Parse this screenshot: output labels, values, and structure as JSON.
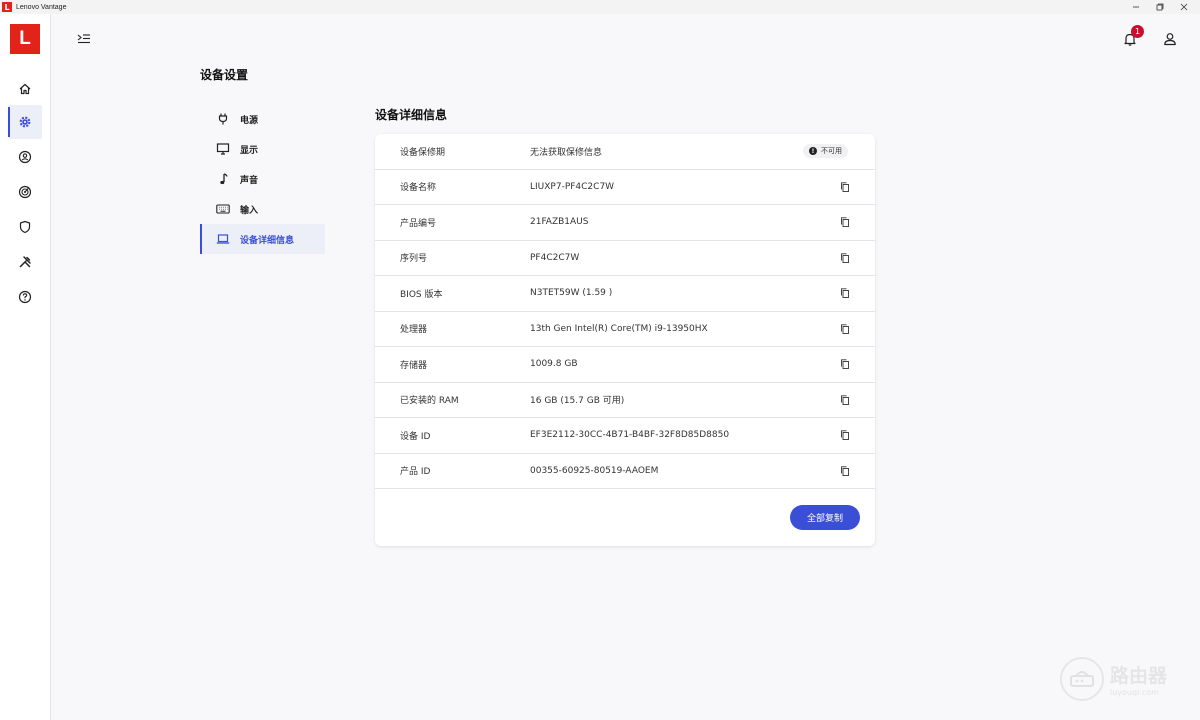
{
  "window": {
    "title": "Lenovo Vantage",
    "logo_letter": "L"
  },
  "brand": {
    "letter": "L",
    "color": "#e2231a"
  },
  "accent_color": "#3b4fd6",
  "sidebar": {
    "items": [
      {
        "name": "home",
        "icon": "home-icon",
        "active": false
      },
      {
        "name": "device-settings",
        "icon": "gear-icon",
        "active": true
      },
      {
        "name": "account",
        "icon": "account-icon",
        "active": false
      },
      {
        "name": "smart-features",
        "icon": "radar-icon",
        "active": false
      },
      {
        "name": "security",
        "icon": "shield-icon",
        "active": false
      },
      {
        "name": "tools",
        "icon": "tools-icon",
        "active": false
      },
      {
        "name": "help",
        "icon": "help-icon",
        "active": false
      }
    ]
  },
  "header": {
    "notification_count": "1"
  },
  "page": {
    "title": "设备设置"
  },
  "submenu": {
    "items": [
      {
        "label": "电源",
        "icon": "plug-icon",
        "active": false
      },
      {
        "label": "显示",
        "icon": "monitor-icon",
        "active": false
      },
      {
        "label": "声音",
        "icon": "music-note-icon",
        "active": false
      },
      {
        "label": "输入",
        "icon": "keyboard-icon",
        "active": false
      },
      {
        "label": "设备详细信息",
        "icon": "laptop-icon",
        "active": true
      }
    ]
  },
  "details": {
    "title": "设备详细信息",
    "rows": [
      {
        "label": "设备保修期",
        "value": "无法获取保修信息",
        "status": "不可用"
      },
      {
        "label": "设备名称",
        "value": "LIUXP7-PF4C2C7W"
      },
      {
        "label": "产品编号",
        "value": "21FAZB1AUS"
      },
      {
        "label": "序列号",
        "value": "PF4C2C7W"
      },
      {
        "label": "BIOS 版本",
        "value": "N3TET59W (1.59 )"
      },
      {
        "label": "处理器",
        "value": "13th Gen Intel(R) Core(TM) i9-13950HX"
      },
      {
        "label": "存储器",
        "value": "1009.8 GB"
      },
      {
        "label": "已安装的 RAM",
        "value": "16 GB (15.7 GB 可用)"
      },
      {
        "label": "设备 ID",
        "value": "EF3E2112-30CC-4B71-B4BF-32F8D85D8850"
      },
      {
        "label": "产品 ID",
        "value": "00355-60925-80519-AAOEM"
      }
    ],
    "copy_all_label": "全部复制"
  },
  "watermark": {
    "name": "路由器",
    "site": "luyouqi.com"
  }
}
